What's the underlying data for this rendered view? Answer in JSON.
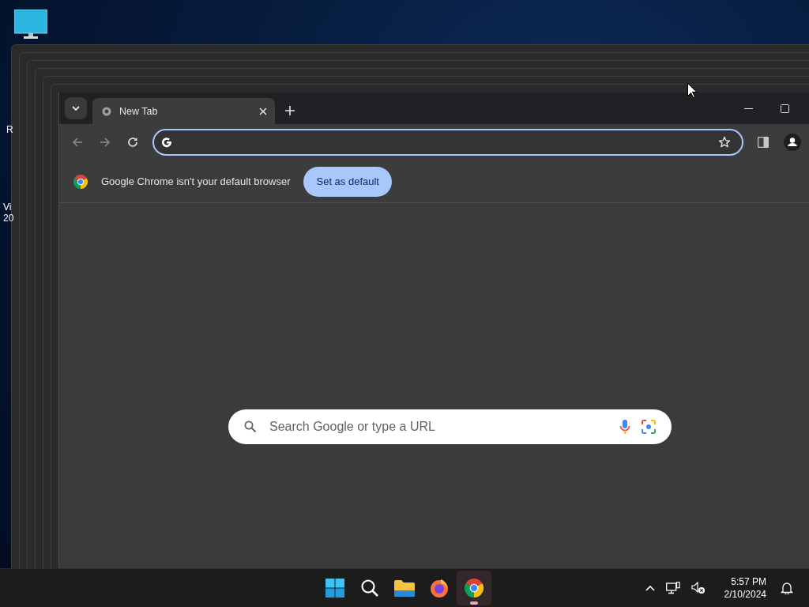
{
  "desktop": {
    "icon_labels": [
      "R",
      "Vi",
      "20"
    ]
  },
  "browser": {
    "tabs": [
      {
        "title": "New Tab",
        "selected": true
      }
    ],
    "nav_buttons": [
      {
        "kind": "back",
        "disabled": true
      },
      {
        "kind": "forward",
        "disabled": true
      },
      {
        "kind": "reload",
        "disabled": false
      }
    ],
    "infobar": {
      "message": "Google Chrome isn't your default browser",
      "button": "Set as default"
    },
    "new_tab_search": {
      "placeholder": "Search Google or type a URL"
    }
  },
  "taskbar": {
    "apps": [
      {
        "kind": "start",
        "selected": false
      },
      {
        "kind": "search",
        "selected": false
      },
      {
        "kind": "files",
        "selected": false
      },
      {
        "kind": "firefox",
        "selected": false
      },
      {
        "kind": "chrome",
        "selected": true
      }
    ],
    "clock": {
      "time": "5:57 PM",
      "date": "2/10/2024"
    }
  }
}
